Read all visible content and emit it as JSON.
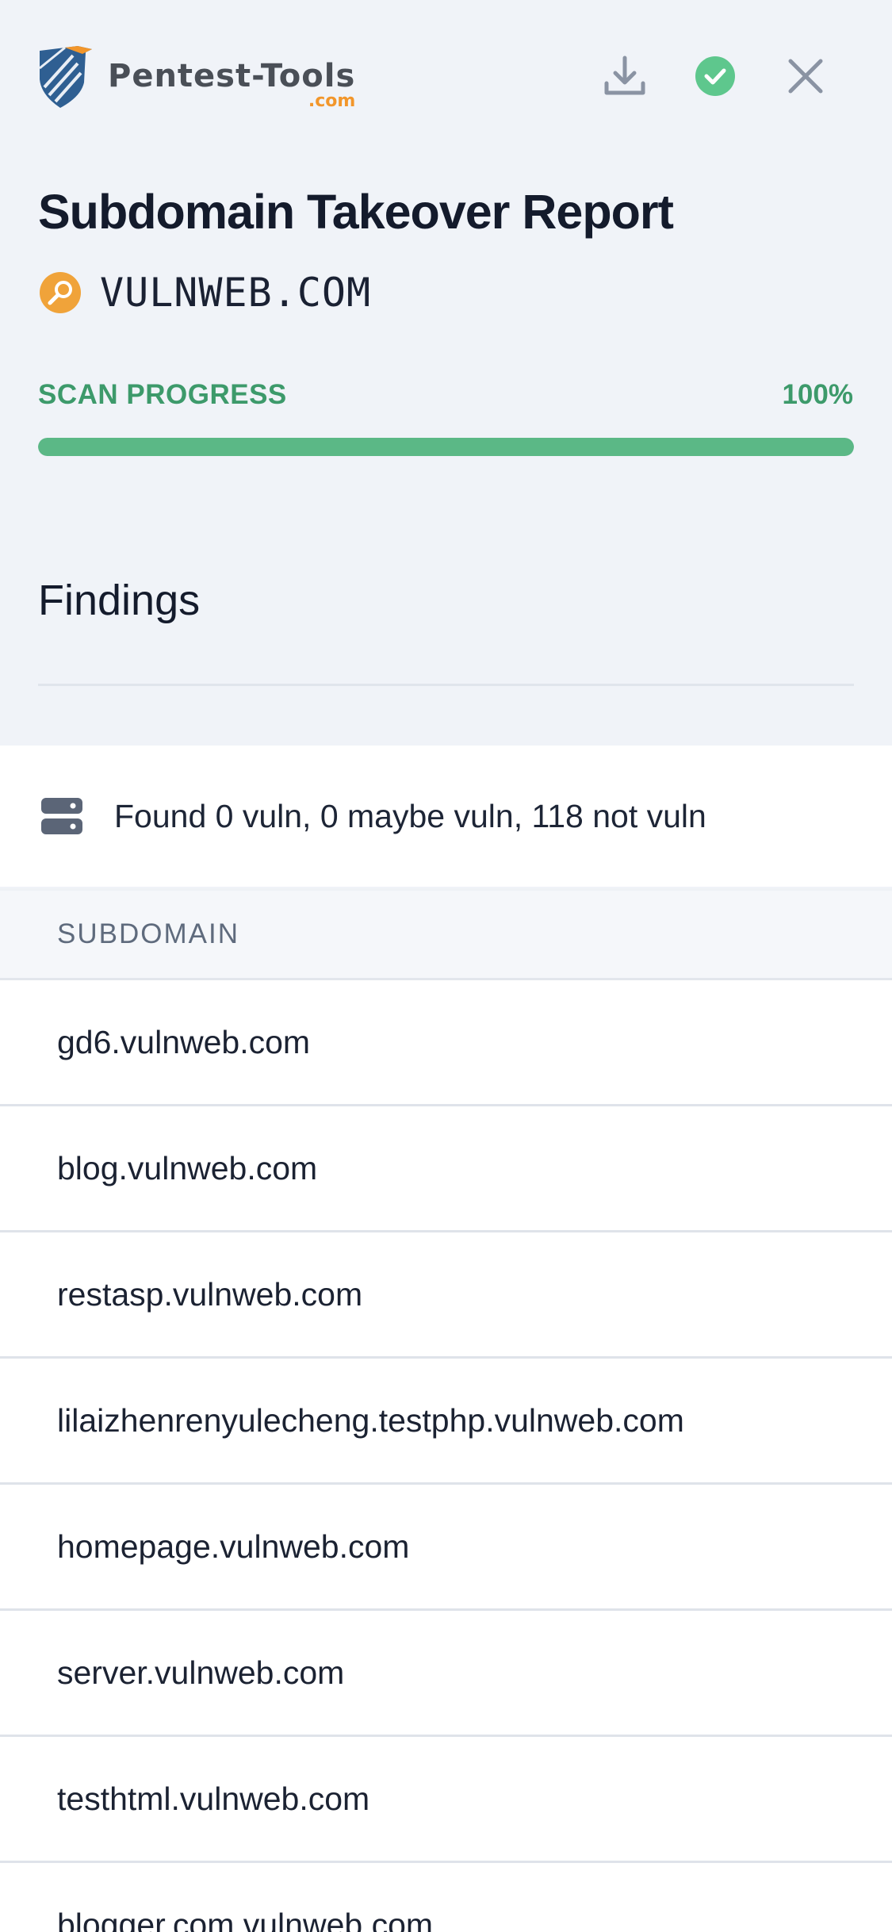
{
  "brand": {
    "name": "Pentest-Tools",
    "suffix": ".com"
  },
  "header": {
    "title": "Subdomain Takeover Report",
    "target": "VULNWEB.COM",
    "icons": [
      "download-icon",
      "check-circle-icon",
      "close-icon"
    ]
  },
  "progress": {
    "label": "SCAN PROGRESS",
    "value_text": "100%",
    "percent": 100
  },
  "findings": {
    "title": "Findings"
  },
  "summary": {
    "icon": "server-icon",
    "text": "Found 0 vuln, 0 maybe vuln, 118 not vuln"
  },
  "table": {
    "header": "SUBDOMAIN",
    "rows": [
      "gd6.vulnweb.com",
      "blog.vulnweb.com",
      "restasp.vulnweb.com",
      "lilaizhenrenyulecheng.testphp.vulnweb.com",
      "homepage.vulnweb.com",
      "server.vulnweb.com",
      "testhtml.vulnweb.com",
      "blogger.com.vulnweb.com"
    ]
  },
  "colors": {
    "background": "#f0f3f8",
    "accent_green": "#5bb886",
    "progress_text": "#3d9a6b",
    "logo_orange": "#f2962b",
    "target_icon": "#f0a33a"
  }
}
